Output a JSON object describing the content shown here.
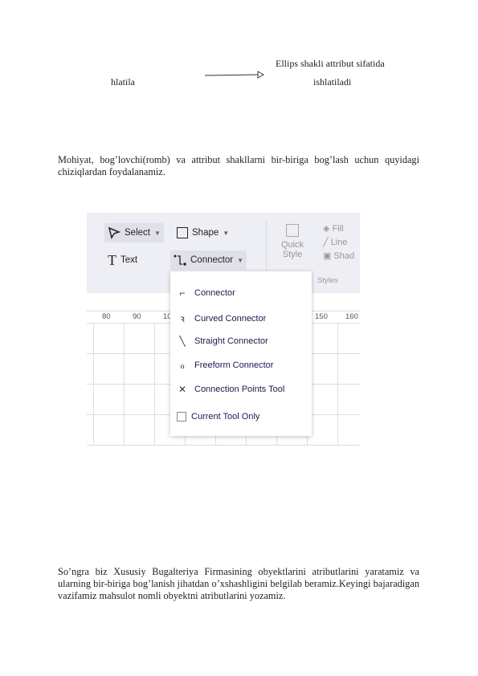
{
  "diagram": {
    "top_label": "Ellips shakli attribut sifatida",
    "left_label": "hlatila",
    "right_label": "ishlatiladi"
  },
  "paragraphs": [
    "Mohiyat, bog’lovchi(romb) va attribut shakllarni bir-biriga bog’lash uchun quyidagi chiziqlardan foydalanamiz.",
    "So’ngra biz Xususiy Bugalteriya Firmasining obyektlarini atributlarini yaratamiz va ularning bir-biriga bog’lanish jihatdan o’xshashligini belgilab beramiz.Keyingi bajaradigan vazifamiz mahsulot nomli obyektni atributlarini yozamiz."
  ],
  "screenshot": {
    "ribbon": {
      "select": "Select",
      "shape": "Shape",
      "text": "Text",
      "connector": "Connector",
      "quick_style_1": "Quick",
      "quick_style_2": "Style",
      "fill": "Fill",
      "line": "Line",
      "shadow": "Shad",
      "styles_group": "Styles"
    },
    "ruler": [
      "80",
      "90",
      "10",
      "150",
      "160"
    ],
    "menu": {
      "items": [
        {
          "label": "Connector",
          "icon": "elbow-connector-icon"
        },
        {
          "label": "Curved Connector",
          "icon": "curved-connector-icon"
        },
        {
          "label": "Straight Connector",
          "icon": "straight-connector-icon"
        },
        {
          "label": "Freeform Connector",
          "icon": "freeform-connector-icon"
        },
        {
          "label": "Connection Points Tool",
          "icon": "connection-points-icon"
        }
      ],
      "checkbox_label": "Current Tool Only",
      "checkbox_checked": false
    }
  }
}
